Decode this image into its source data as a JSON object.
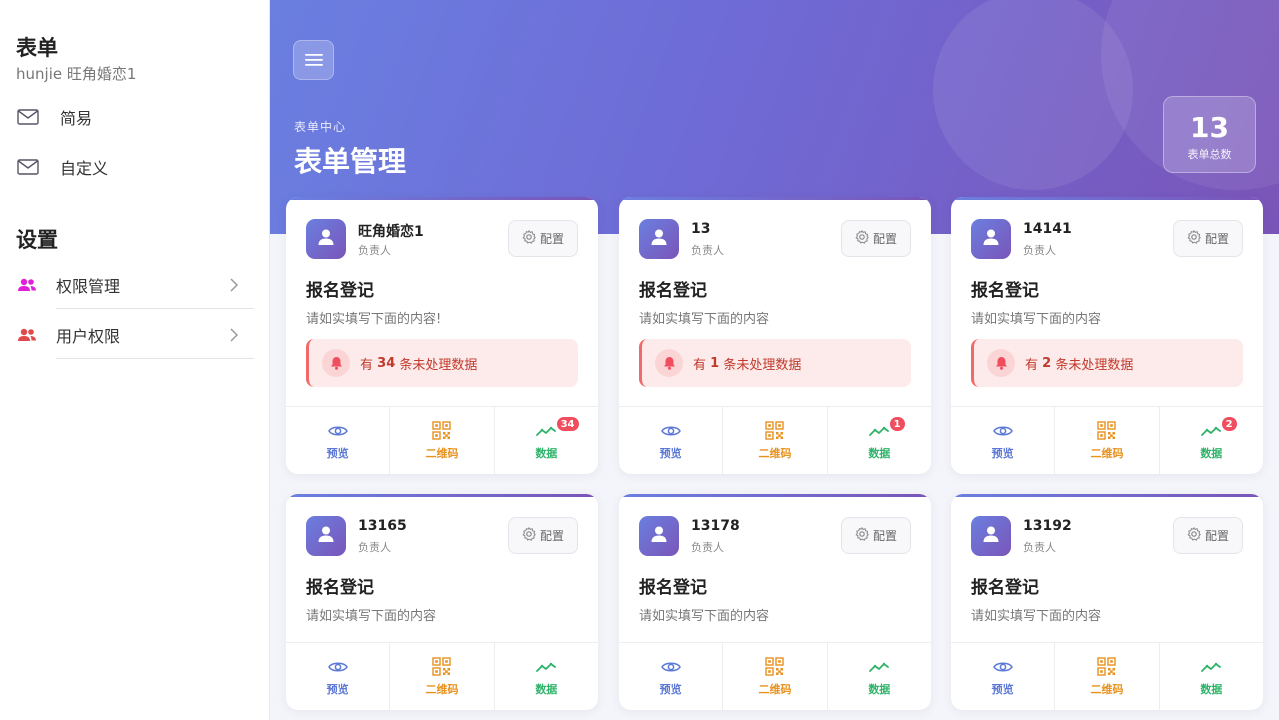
{
  "sidebar": {
    "title": "表单",
    "subtitle": "hunjie 旺角婚恋1",
    "items": [
      {
        "label": "简易",
        "icon": "mail-icon"
      },
      {
        "label": "自定义",
        "icon": "mail-icon"
      }
    ],
    "settings_title": "设置",
    "settings": [
      {
        "label": "权限管理",
        "icon": "users-icon",
        "icon_color": "#e020d8"
      },
      {
        "label": "用户权限",
        "icon": "users-icon",
        "icon_color": "#e04a4a"
      }
    ]
  },
  "header": {
    "eyebrow": "表单中心",
    "title": "表单管理",
    "count": "13",
    "count_label": "表单总数"
  },
  "card_labels": {
    "config": "配置",
    "owner_label": "负责人",
    "view": "预览",
    "qr": "二维码",
    "data": "数据",
    "alert_prefix": "有",
    "alert_suffix": "条未处理数据"
  },
  "cards": [
    {
      "owner": "旺角婚恋1",
      "title": "报名登记",
      "desc": "请如实填写下面的内容!",
      "pending": "34"
    },
    {
      "owner": "13",
      "title": "报名登记",
      "desc": "请如实填写下面的内容",
      "pending": "1"
    },
    {
      "owner": "14141",
      "title": "报名登记",
      "desc": "请如实填写下面的内容",
      "pending": "2"
    },
    {
      "owner": "13165",
      "title": "报名登记",
      "desc": "请如实填写下面的内容"
    },
    {
      "owner": "13178",
      "title": "报名登记",
      "desc": "请如实填写下面的内容"
    },
    {
      "owner": "13192",
      "title": "报名登记",
      "desc": "请如实填写下面的内容"
    }
  ],
  "colors": {
    "accent_start": "#6a7fe0",
    "accent_end": "#7a55b8",
    "view": "#5b78d6",
    "qr": "#e8921f",
    "data": "#2fb36a",
    "alert": "#c0392b",
    "badge": "#f04d5e"
  }
}
